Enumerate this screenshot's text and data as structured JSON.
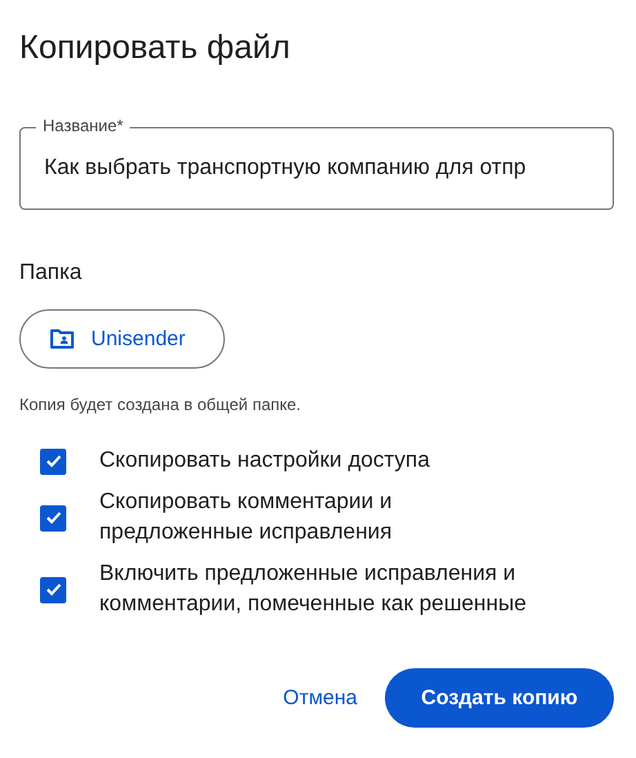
{
  "dialog": {
    "title": "Копировать файл"
  },
  "name_field": {
    "label": "Название*",
    "value": "Как выбрать транспортную компанию для отпр"
  },
  "folder": {
    "label": "Папка",
    "button": "Unisender",
    "note": "Копия будет создана в общей папке."
  },
  "options": [
    {
      "label": "Скопировать настройки доступа",
      "checked": true
    },
    {
      "label": "Скопировать комментарии и\nпредложенные исправления",
      "checked": true
    },
    {
      "label": "Включить предложенные исправления и\nкомментарии, помеченные как решенные",
      "checked": true
    }
  ],
  "buttons": {
    "cancel": "Отмена",
    "confirm": "Создать копию"
  }
}
